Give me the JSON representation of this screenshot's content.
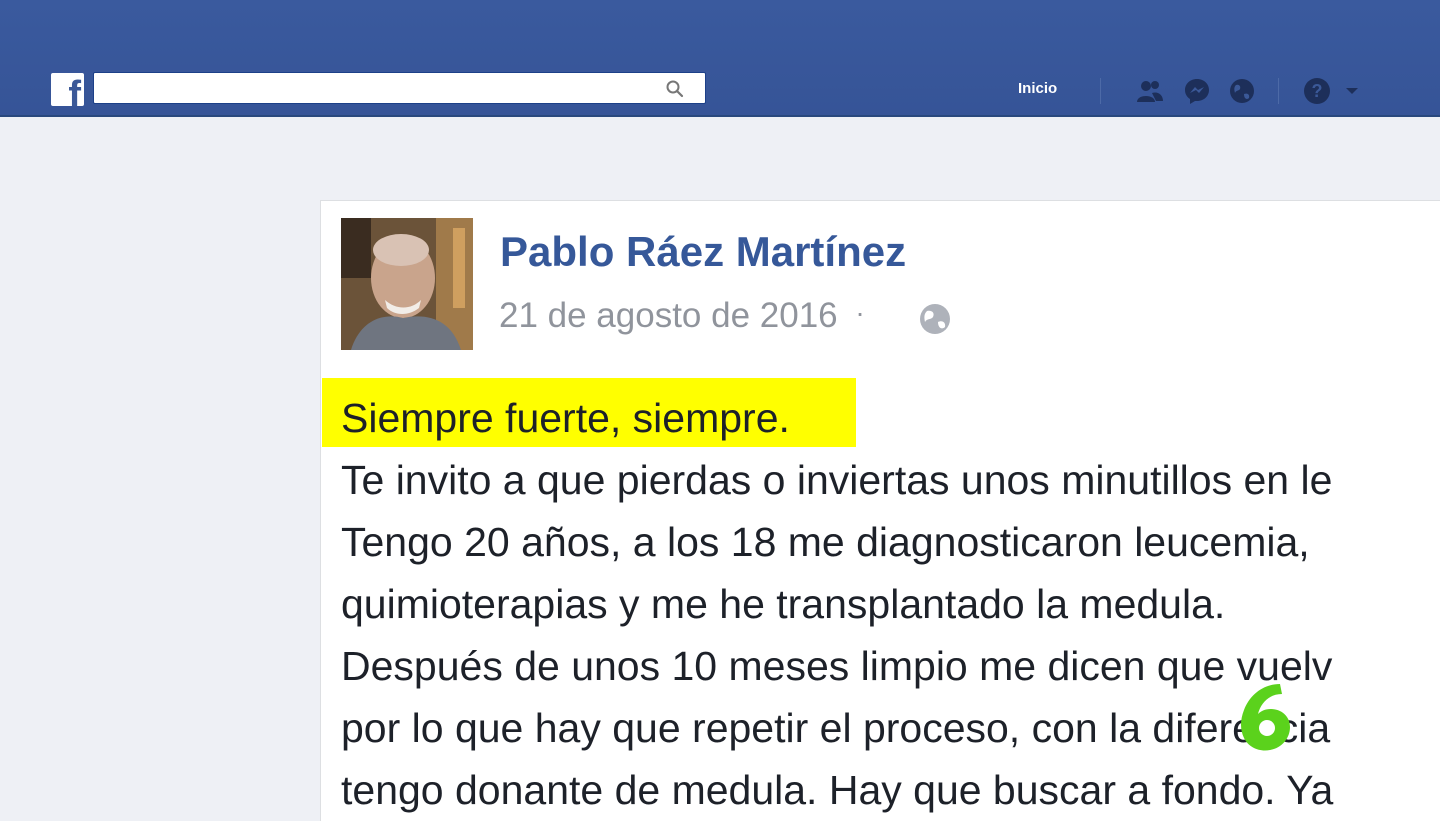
{
  "header": {
    "logo_letter": "f",
    "search": {
      "placeholder": ""
    },
    "home_label": "Inicio",
    "icons": [
      "friends-icon",
      "messenger-icon",
      "globe-icon",
      "help-icon",
      "caret-down-icon"
    ]
  },
  "post": {
    "author": "Pablo Ráez Martínez",
    "date": "21 de agosto de 2016",
    "separator": "·",
    "highlighted_line": "Siempre fuerte, siempre.",
    "lines": [
      "Te invito a que pierdas o inviertas unos minutillos en le",
      "Tengo 20 años, a los 18 me diagnosticaron leucemia,",
      "quimioterapias y me he transplantado la medula.",
      "Después de unos 10 meses limpio me dicen que vuelv",
      "por lo que hay que repetir el proceso, con la diferencia",
      "tengo donante de medula. Hay que buscar a fondo. Ya"
    ]
  },
  "colors": {
    "brand_blue": "#3b5998",
    "author_blue": "#365899",
    "highlight_yellow": "#ffff00",
    "watermark_green": "#5bd21c"
  }
}
